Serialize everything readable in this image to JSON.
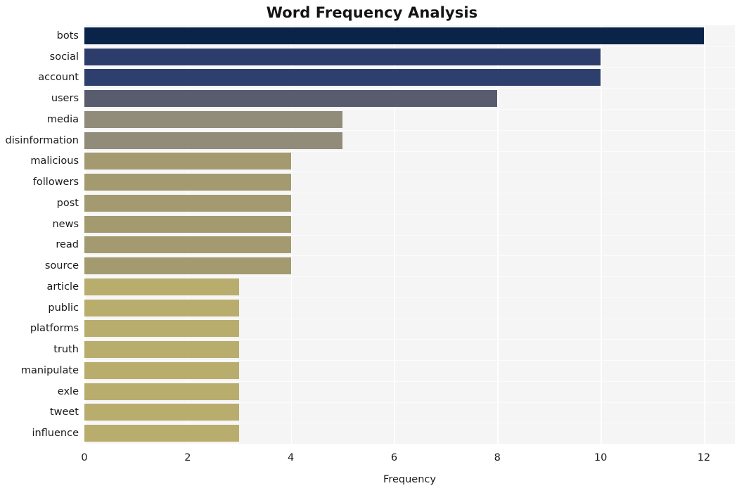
{
  "chart_data": {
    "type": "bar",
    "orientation": "horizontal",
    "title": "Word Frequency Analysis",
    "xlabel": "Frequency",
    "ylabel": "",
    "xlim": [
      0,
      12.6
    ],
    "ylim": [
      0,
      20
    ],
    "grid": true,
    "legend": false,
    "xticks": [
      0,
      2,
      4,
      6,
      8,
      10,
      12
    ],
    "xtick_labels": [
      "0",
      "2",
      "4",
      "6",
      "8",
      "10",
      "12"
    ],
    "categories": [
      "bots",
      "social",
      "account",
      "users",
      "media",
      "disinformation",
      "malicious",
      "followers",
      "post",
      "news",
      "read",
      "source",
      "article",
      "public",
      "platforms",
      "truth",
      "manipulate",
      "exle",
      "tweet",
      "influence"
    ],
    "values": [
      12,
      10,
      10,
      8,
      5,
      5,
      4,
      4,
      4,
      4,
      4,
      4,
      3,
      3,
      3,
      3,
      3,
      3,
      3,
      3
    ],
    "bar_colors": [
      "#0a2349",
      "#2d3d6b",
      "#2e3f6e",
      "#585c6e",
      "#918b7a",
      "#918b7a",
      "#a39a70",
      "#a39a70",
      "#a39a70",
      "#a39a70",
      "#a39a70",
      "#a39a70",
      "#b9ad6d",
      "#b9ad6d",
      "#b9ad6d",
      "#b9ad6d",
      "#b9ad6d",
      "#b9ad6d",
      "#b9ad6d",
      "#b9ad6d"
    ],
    "colors": {
      "plot_background": "#f5f5f6",
      "figure_background": "#ffffff",
      "gridline": "#ffffff",
      "text": "#1a1a1a",
      "title": "#141414"
    }
  }
}
